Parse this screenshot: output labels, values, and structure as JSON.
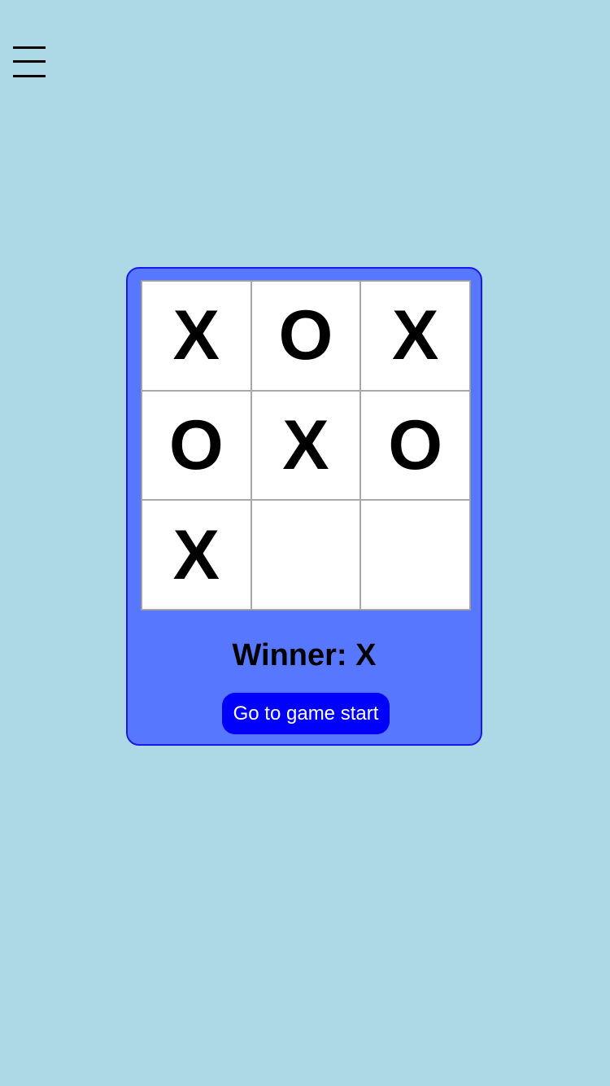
{
  "menu": {
    "icon": "hamburger-menu-icon"
  },
  "board": {
    "cells": [
      "X",
      "O",
      "X",
      "O",
      "X",
      "O",
      "X",
      "",
      ""
    ]
  },
  "status": {
    "text": "Winner: X"
  },
  "restart_button": {
    "label": "Go to game start"
  },
  "colors": {
    "page_background": "#add8e6",
    "card_background": "#5877ff",
    "card_border": "#1a1ae6",
    "button_background": "#0000ff",
    "button_text": "#ffffff",
    "cell_background": "#ffffff"
  }
}
